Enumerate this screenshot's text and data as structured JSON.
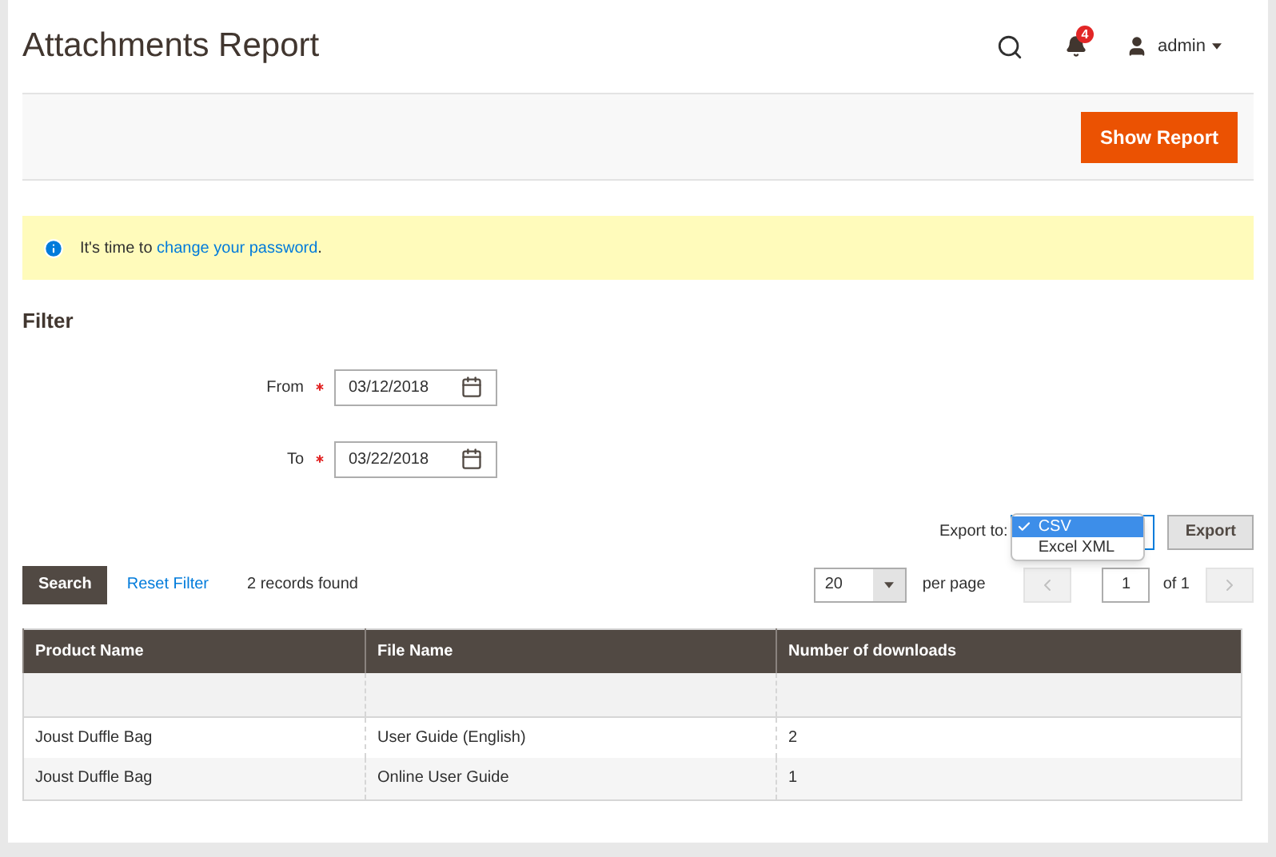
{
  "page_title": "Attachments Report",
  "header": {
    "notification_count": "4",
    "user": "admin"
  },
  "actions": {
    "show_report": "Show Report"
  },
  "notice": {
    "text": "It's time to ",
    "link": "change your password",
    "after": "."
  },
  "filter": {
    "title": "Filter",
    "fields": [
      {
        "label": "From",
        "required": true,
        "value": "03/12/2018"
      },
      {
        "label": "To",
        "required": true,
        "value": "03/22/2018"
      }
    ]
  },
  "export": {
    "label": "Export to:",
    "options": [
      {
        "label": "CSV",
        "selected": true
      },
      {
        "label": "Excel XML",
        "selected": false
      }
    ],
    "button": "Export"
  },
  "grid_toolbar": {
    "search": "Search",
    "reset": "Reset Filter",
    "records": "2 records found",
    "per_page_value": "20",
    "per_page_label": "per page",
    "page": "1",
    "of_pages": "of 1"
  },
  "table": {
    "columns": [
      "Product Name",
      "File Name",
      "Number of downloads"
    ],
    "rows": [
      [
        "Joust Duffle Bag",
        "User Guide (English)",
        "2"
      ],
      [
        "Joust Duffle Bag",
        "Online User Guide",
        "1"
      ]
    ]
  }
}
